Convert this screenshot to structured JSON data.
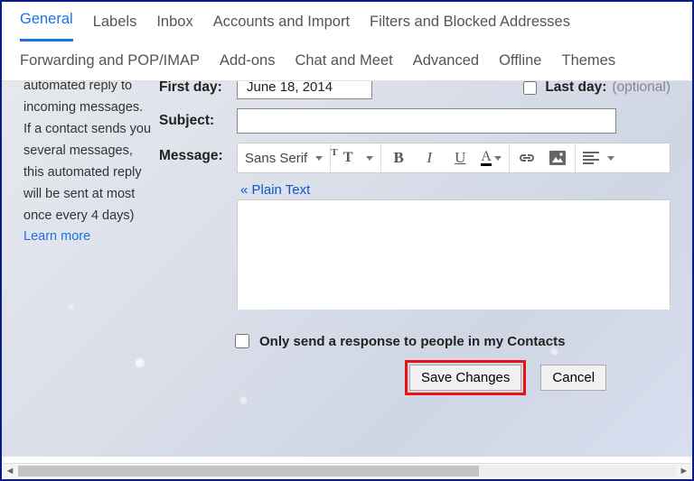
{
  "tabs": {
    "row1": [
      "General",
      "Labels",
      "Inbox",
      "Accounts and Import",
      "Filters and Blocked Addresses"
    ],
    "row2": [
      "Forwarding and POP/IMAP",
      "Add-ons",
      "Chat and Meet",
      "Advanced",
      "Offline",
      "Themes"
    ],
    "active": "General"
  },
  "description": {
    "text": "automated reply to incoming messages. If a contact sends you several messages, this automated reply will be sent at most once every 4 days)",
    "learn_more": "Learn more"
  },
  "first_day": {
    "label": "First day:",
    "value": "June 18, 2014"
  },
  "last_day": {
    "label": "Last day:",
    "hint": "(optional)",
    "checked": false
  },
  "subject": {
    "label": "Subject:",
    "value": ""
  },
  "message": {
    "label": "Message:"
  },
  "toolbar": {
    "font": "Sans Serif"
  },
  "plain_text_link": "« Plain Text",
  "contacts_only": {
    "label": "Only send a response to people in my Contacts",
    "checked": false
  },
  "buttons": {
    "save": "Save Changes",
    "cancel": "Cancel"
  }
}
